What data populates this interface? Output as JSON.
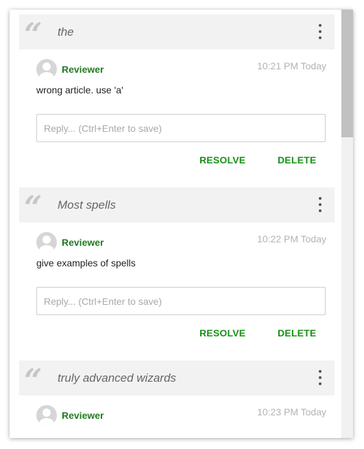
{
  "colors": {
    "accent_green": "#179117",
    "reviewer_green": "#217a21",
    "quote_bar_bg": "#f2f2f2",
    "timestamp_gray": "#b3b3b3"
  },
  "threads": [
    {
      "quote": "the",
      "quote_icon": "quote-icon",
      "menu_icon": "kebab-menu-icon",
      "author": "Reviewer",
      "avatar_icon": "user-avatar-icon",
      "time": "10:21 PM Today",
      "text": "wrong article. use 'a'",
      "reply_placeholder": "Reply... (Ctrl+Enter to save)",
      "reply_value": "",
      "resolve_label": "RESOLVE",
      "delete_label": "DELETE"
    },
    {
      "quote": "Most spells",
      "quote_icon": "quote-icon",
      "menu_icon": "kebab-menu-icon",
      "author": "Reviewer",
      "avatar_icon": "user-avatar-icon",
      "time": "10:22 PM Today",
      "text": "give examples of spells",
      "reply_placeholder": "Reply... (Ctrl+Enter to save)",
      "reply_value": "",
      "resolve_label": "RESOLVE",
      "delete_label": "DELETE"
    },
    {
      "quote": "truly advanced wizards",
      "quote_icon": "quote-icon",
      "menu_icon": "kebab-menu-icon",
      "author": "Reviewer",
      "avatar_icon": "user-avatar-icon",
      "time": "10:23 PM Today"
    }
  ]
}
